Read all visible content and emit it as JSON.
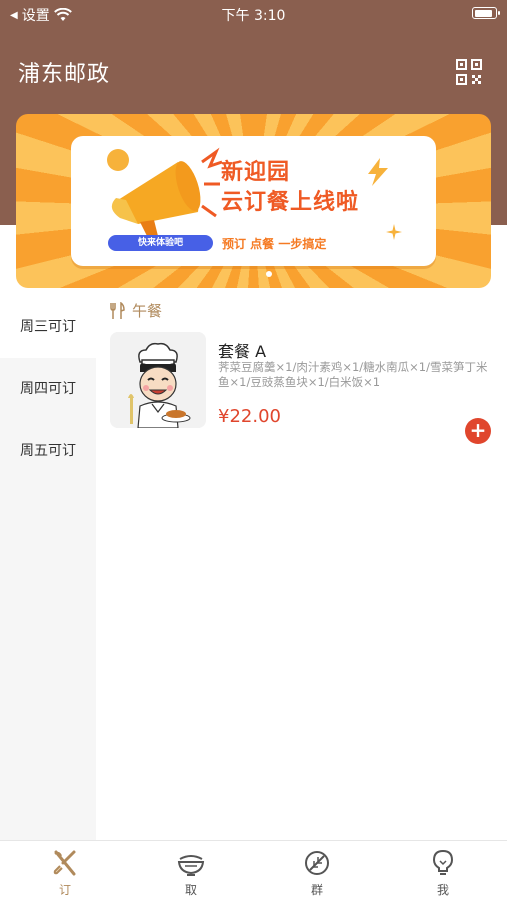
{
  "status_bar": {
    "back_label": "设置",
    "time": "下午 3:10",
    "battery_level": 0.9
  },
  "header": {
    "title": "浦东邮政",
    "qr_icon": "qr-code-icon"
  },
  "banner": {
    "title_line1": "新迎园",
    "title_line2": "云订餐上线啦",
    "pill_text": "快来体验吧",
    "subtitle": "预订 点餐 一步搞定",
    "colors": {
      "rays_dark": "#f9a12f",
      "rays_light": "#fcc35a",
      "title": "#ef5a24",
      "pill": "#4760e6"
    }
  },
  "day_menu": {
    "items": [
      {
        "label": "周三可订",
        "active": true
      },
      {
        "label": "周四可订",
        "active": false
      },
      {
        "label": "周五可订",
        "active": false
      }
    ]
  },
  "section": {
    "label": "午餐",
    "icon": "utensils-icon"
  },
  "dish": {
    "name": "套餐 A",
    "description": "荠菜豆腐羹×1/肉汁素鸡×1/糖水南瓜×1/雪菜笋丁米鱼×1/豆豉蒸鱼块×1/白米饭×1",
    "price": "¥22.00",
    "add_label": "+"
  },
  "tabbar": {
    "items": [
      {
        "label": "订",
        "icon": "cutlery-cross-icon",
        "active": true
      },
      {
        "label": "取",
        "icon": "food-bowl-icon",
        "active": false
      },
      {
        "label": "群",
        "icon": "leaf-icon",
        "active": false
      },
      {
        "label": "我",
        "icon": "lightbulb-icon",
        "active": false
      }
    ]
  },
  "colors": {
    "header": "#8a5f4f",
    "accent": "#b08a5c",
    "price": "#e0462d"
  }
}
